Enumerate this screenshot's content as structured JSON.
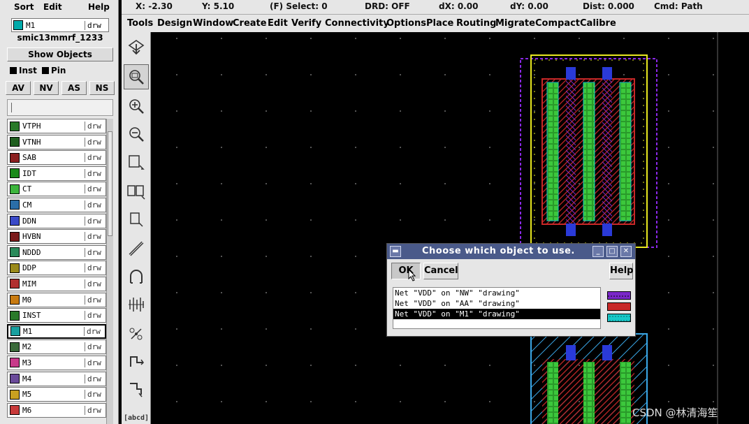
{
  "lsw": {
    "menu": [
      "Sort",
      "Edit",
      "Help"
    ],
    "current_layer": {
      "name": "M1",
      "purpose": "drw"
    },
    "tech_lib": "smic13mmrf_1233",
    "show_objects": "Show Objects",
    "checks": [
      "Inst",
      "Pin"
    ],
    "vis_buttons": [
      "AV",
      "NV",
      "AS",
      "NS"
    ],
    "layers": [
      {
        "name": "VTPH",
        "purpose": "drw",
        "color": "#2a7a2a"
      },
      {
        "name": "VTNH",
        "purpose": "drw",
        "color": "#1e5e1e"
      },
      {
        "name": "SAB",
        "purpose": "drw",
        "color": "#8b2020"
      },
      {
        "name": "IDT",
        "purpose": "drw",
        "color": "#1a8a1a"
      },
      {
        "name": "CT",
        "purpose": "drw",
        "color": "#3cb43c"
      },
      {
        "name": "CM",
        "purpose": "drw",
        "color": "#2b6ea8"
      },
      {
        "name": "DDN",
        "purpose": "drw",
        "color": "#3a4ac8"
      },
      {
        "name": "HVBN",
        "purpose": "drw",
        "color": "#7a1a1a"
      },
      {
        "name": "NDDD",
        "purpose": "drw",
        "color": "#2a8a5a"
      },
      {
        "name": "DDP",
        "purpose": "drw",
        "color": "#9a8a1a"
      },
      {
        "name": "MIM",
        "purpose": "drw",
        "color": "#b03030"
      },
      {
        "name": "M0",
        "purpose": "drw",
        "color": "#c87a10"
      },
      {
        "name": "INST",
        "purpose": "drw",
        "color": "#2a7a2a"
      },
      {
        "name": "M1",
        "purpose": "drw",
        "color": "#18a0a0"
      },
      {
        "name": "M2",
        "purpose": "drw",
        "color": "#3a6a3a"
      },
      {
        "name": "M3",
        "purpose": "drw",
        "color": "#c83a8a"
      },
      {
        "name": "M4",
        "purpose": "drw",
        "color": "#6a4a9a"
      },
      {
        "name": "M5",
        "purpose": "drw",
        "color": "#c8a020"
      },
      {
        "name": "M6",
        "purpose": "drw",
        "color": "#c83a3a"
      }
    ]
  },
  "status": {
    "x": "X: -2.30",
    "y": "Y: 5.10",
    "select": "(F) Select: 0",
    "drd": "DRD: OFF",
    "dx": "dX: 0.00",
    "dy": "dY: 0.00",
    "dist": "Dist: 0.000",
    "cmd": "Cmd: Path"
  },
  "menu": [
    "Tools",
    "Design",
    "Window",
    "Create",
    "Edit",
    "Verify",
    "Connectivity",
    "Options",
    "Place",
    "Routing",
    "Migrate",
    "Compact",
    "Calibre"
  ],
  "toolbar": {
    "icons": [
      "save-icon",
      "zoom-fit-icon",
      "zoom-in-icon",
      "zoom-out-icon",
      "stretch-icon",
      "copy-icon",
      "move-icon",
      "path-icon",
      "arc-icon",
      "undo-icon",
      "property-icon",
      "ruler-icon",
      "label-icon"
    ],
    "label_text": "[abcd]"
  },
  "dialog": {
    "title": "Choose which object to use.",
    "ok": "OK",
    "cancel": "Cancel",
    "help": "Help",
    "items": [
      {
        "text": "Net \"VDD\" on \"NW\" \"drawing\"",
        "color": "#7a28c8"
      },
      {
        "text": "Net \"VDD\" on \"AA\" \"drawing\"",
        "color": "#c82828"
      },
      {
        "text": "Net \"VDD\" on \"M1\" \"drawing\"",
        "color": "#18c8c8"
      }
    ],
    "selected_index": 2
  },
  "watermark": "CSDN @林清海笙"
}
